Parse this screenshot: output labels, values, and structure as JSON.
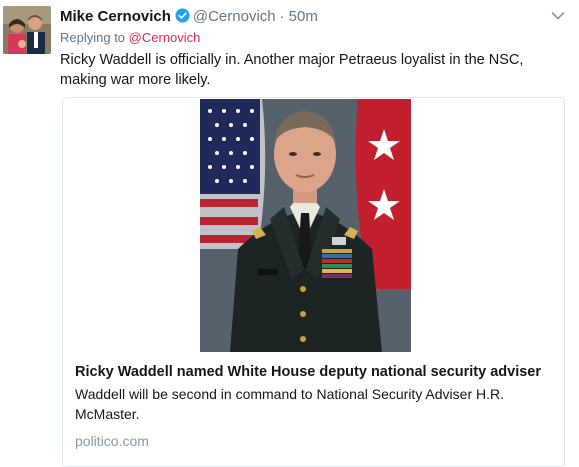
{
  "tweet": {
    "author_name": "Mike Cernovich",
    "handle": "@Cernovich",
    "separator": "·",
    "time": "50m",
    "reply_prefix": "Replying to",
    "reply_to": "@Cernovich",
    "text": "Ricky Waddell is officially in. Another major Petraeus loyalist in the NSC, making war more likely."
  },
  "card": {
    "title": "Ricky Waddell named White House deputy national security adviser",
    "description": "Waddell will be second in command to National Security Adviser H.R. McMaster.",
    "domain": "politico.com"
  },
  "icons": {
    "verified": "verified-badge-icon",
    "caret": "chevron-down-icon"
  },
  "colors": {
    "name": "#14171a",
    "muted": "#657786",
    "reply_link": "#e0245e",
    "verified": "#1da1f2",
    "domain": "#8899a6"
  }
}
